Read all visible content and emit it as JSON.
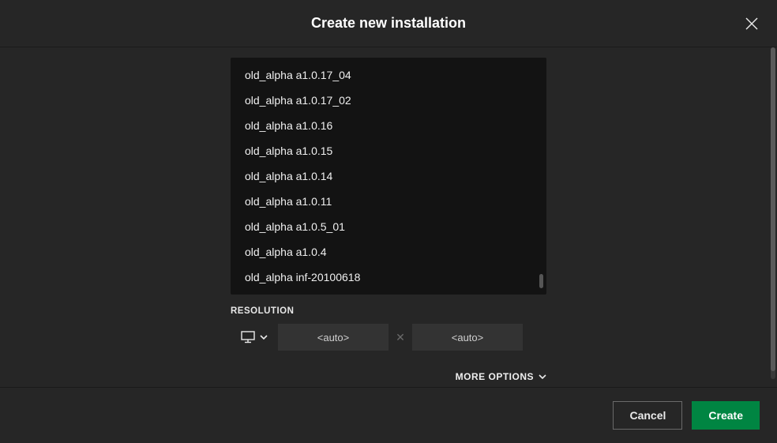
{
  "header": {
    "title": "Create new installation"
  },
  "dropdown": {
    "items": [
      "old_alpha a1.0.17_04",
      "old_alpha a1.0.17_02",
      "old_alpha a1.0.16",
      "old_alpha a1.0.15",
      "old_alpha a1.0.14",
      "old_alpha a1.0.11",
      "old_alpha a1.0.5_01",
      "old_alpha a1.0.4",
      "old_alpha inf-20100618"
    ]
  },
  "resolution": {
    "label": "RESOLUTION",
    "width_placeholder": "<auto>",
    "height_placeholder": "<auto>",
    "separator": "✕"
  },
  "more_options": {
    "label": "MORE OPTIONS"
  },
  "footer": {
    "cancel": "Cancel",
    "create": "Create"
  }
}
